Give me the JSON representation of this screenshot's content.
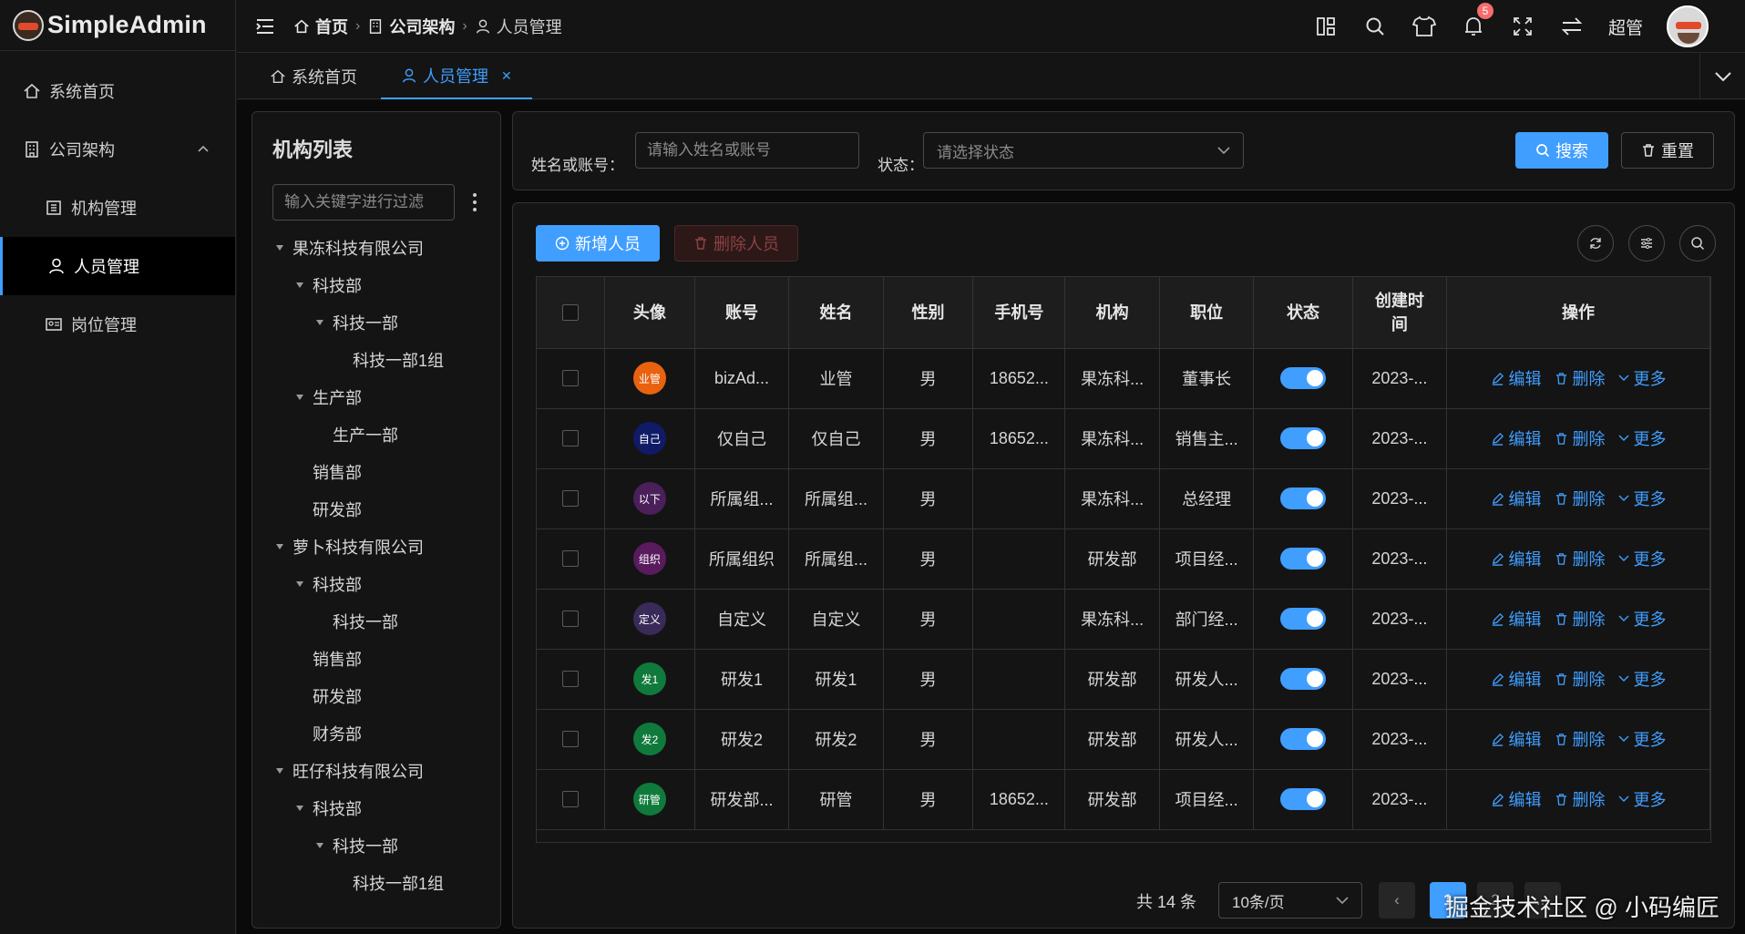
{
  "app": {
    "name": "SimpleAdmin"
  },
  "sidebar": {
    "items": [
      {
        "label": "系统首页"
      },
      {
        "label": "公司架构"
      },
      {
        "label": "机构管理"
      },
      {
        "label": "人员管理"
      },
      {
        "label": "岗位管理"
      }
    ]
  },
  "header": {
    "breadcrumb": [
      "首页",
      "公司架构",
      "人员管理"
    ],
    "notification_count": "5",
    "username": "超管"
  },
  "tabs": [
    {
      "label": "系统首页"
    },
    {
      "label": "人员管理"
    }
  ],
  "tree": {
    "title": "机构列表",
    "filter_placeholder": "输入关键字进行过滤",
    "nodes": [
      {
        "label": "果冻科技有限公司",
        "level": 0,
        "caret": true
      },
      {
        "label": "科技部",
        "level": 1,
        "caret": true
      },
      {
        "label": "科技一部",
        "level": 2,
        "caret": true
      },
      {
        "label": "科技一部1组",
        "level": 3,
        "caret": false
      },
      {
        "label": "生产部",
        "level": 1,
        "caret": true
      },
      {
        "label": "生产一部",
        "level": 2,
        "caret": false
      },
      {
        "label": "销售部",
        "level": 1,
        "caret": false
      },
      {
        "label": "研发部",
        "level": 1,
        "caret": false
      },
      {
        "label": "萝卜科技有限公司",
        "level": 0,
        "caret": true
      },
      {
        "label": "科技部",
        "level": 1,
        "caret": true
      },
      {
        "label": "科技一部",
        "level": 2,
        "caret": false
      },
      {
        "label": "销售部",
        "level": 1,
        "caret": false
      },
      {
        "label": "研发部",
        "level": 1,
        "caret": false
      },
      {
        "label": "财务部",
        "level": 1,
        "caret": false
      },
      {
        "label": "旺仔科技有限公司",
        "level": 0,
        "caret": true
      },
      {
        "label": "科技部",
        "level": 1,
        "caret": true
      },
      {
        "label": "科技一部",
        "level": 2,
        "caret": true
      },
      {
        "label": "科技一部1组",
        "level": 3,
        "caret": false
      }
    ]
  },
  "search": {
    "name_label": "姓名或账号：",
    "name_placeholder": "请输入姓名或账号",
    "status_label": "状态：",
    "status_placeholder": "请选择状态",
    "search_button": "搜索",
    "reset_button": "重置"
  },
  "toolbar": {
    "add_button": "新增人员",
    "delete_button": "删除人员"
  },
  "table": {
    "columns": [
      "头像",
      "账号",
      "姓名",
      "性别",
      "手机号",
      "机构",
      "职位",
      "状态",
      "创建时间",
      "操作"
    ],
    "ops": {
      "edit": "编辑",
      "delete": "删除",
      "more": "更多"
    },
    "rows": [
      {
        "avatar_text": "业管",
        "avatar_color": "#e8620f",
        "account": "bizAd...",
        "name": "业管",
        "gender": "男",
        "phone": "18652...",
        "org": "果冻科...",
        "position": "董事长",
        "status": true,
        "created": "2023-..."
      },
      {
        "avatar_text": "自己",
        "avatar_color": "#0f1b66",
        "account": "仅自己",
        "name": "仅自己",
        "gender": "男",
        "phone": "18652...",
        "org": "果冻科...",
        "position": "销售主...",
        "status": true,
        "created": "2023-..."
      },
      {
        "avatar_text": "以下",
        "avatar_color": "#4a1f5a",
        "account": "所属组...",
        "name": "所属组...",
        "gender": "男",
        "phone": "",
        "org": "果冻科...",
        "position": "总经理",
        "status": true,
        "created": "2023-..."
      },
      {
        "avatar_text": "组织",
        "avatar_color": "#5a1a5e",
        "account": "所属组织",
        "name": "所属组...",
        "gender": "男",
        "phone": "",
        "org": "研发部",
        "position": "项目经...",
        "status": true,
        "created": "2023-..."
      },
      {
        "avatar_text": "定义",
        "avatar_color": "#3a2a5a",
        "account": "自定义",
        "name": "自定义",
        "gender": "男",
        "phone": "",
        "org": "果冻科...",
        "position": "部门经...",
        "status": true,
        "created": "2023-..."
      },
      {
        "avatar_text": "发1",
        "avatar_color": "#0f7a3c",
        "account": "研发1",
        "name": "研发1",
        "gender": "男",
        "phone": "",
        "org": "研发部",
        "position": "研发人...",
        "status": true,
        "created": "2023-..."
      },
      {
        "avatar_text": "发2",
        "avatar_color": "#0f7a3c",
        "account": "研发2",
        "name": "研发2",
        "gender": "男",
        "phone": "",
        "org": "研发部",
        "position": "研发人...",
        "status": true,
        "created": "2023-..."
      },
      {
        "avatar_text": "研管",
        "avatar_color": "#0f7a3c",
        "account": "研发部...",
        "name": "研管",
        "gender": "男",
        "phone": "18652...",
        "org": "研发部",
        "position": "项目经...",
        "status": true,
        "created": "2023-..."
      }
    ]
  },
  "pagination": {
    "total": "共 14 条",
    "page_size": "10条/页",
    "pages": [
      "1",
      "2",
      "..."
    ],
    "current": "1"
  },
  "watermark": "掘金技术社区 @ 小码编匠",
  "colors": {
    "accent": "#409eff",
    "danger": "#f56c6c",
    "bg": "#141414"
  }
}
